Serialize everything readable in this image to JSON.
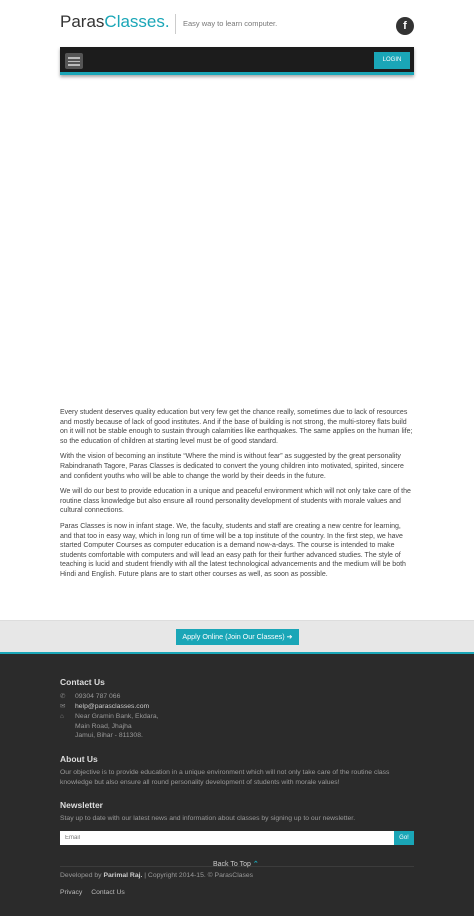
{
  "header": {
    "logo_part1": "Paras",
    "logo_part2": "Classes.",
    "tagline": "Easy way to learn computer.",
    "facebook_glyph": "f"
  },
  "navbar": {
    "login_label": "LOGIN"
  },
  "content": {
    "paragraphs": [
      "Every student deserves quality education but very few get the chance really, sometimes due to lack of resources and mostly because of lack of good institutes. And if the base of building is not strong, the multi-storey flats build on it will not be stable enough to sustain through calamities like earthquakes. The same applies on the human life; so the education of children at starting level must be of good standard.",
      "With the vision of becoming an institute “Where the mind is without fear” as suggested by the great personality Rabindranath Tagore, Paras Classes is dedicated to convert the young children into motivated, spirited, sincere and confident youths who will be able to change the world by their deeds in the future.",
      "We will do our best to provide education in a unique and peaceful environment which will not only take care of the routine class knowledge but also ensure all round personality development of students with morale values and cultural connections.",
      "Paras Classes is now in infant stage. We, the faculty, students and staff are creating a new centre for learning, and that too in easy way, which in long run of time will be a top institute of the country. In the first step, we have started Computer Courses as computer education is a demand now-a-days. The course is intended to make students comfortable with computers and will lead an easy path for their further advanced studies. The style of teaching is lucid and student friendly with all the latest technological advancements and the medium will be both Hindi and English. Future plans are to start other courses as well, as soon as possible."
    ]
  },
  "cta": {
    "label": "Apply Online (Join Our Classes) ➔"
  },
  "footer": {
    "contact_heading": "Contact Us",
    "phone": "09304 787 066",
    "email": "help@parasclasses.com",
    "address_line1": "Near Gramin Bank, Ekdara,",
    "address_line2": "Main Road, Jhajha",
    "address_line3": "Jamui, Bihar - 811308.",
    "about_heading": "About Us",
    "about_text": "Our objective is to provide education in a unique environment which will not only take care of the routine class knowledge but also ensure all round personality development of students with morale values!",
    "newsletter_heading": "Newsletter",
    "newsletter_text": "Stay up to date with our latest news and information about classes by signing up to our newsletter.",
    "email_placeholder": "Email",
    "go_label": "Go!",
    "back_to_top": "Back To Top",
    "developed_prefix": "Developed by",
    "developer": "Parimal Raj.",
    "copyright": "| Copyright 2014-15. © ParasClases",
    "links": [
      "Privacy",
      "Contact Us"
    ]
  },
  "colors": {
    "accent": "#1aa6b7",
    "navbar_bg": "#1c1c1c",
    "footer_bg": "#2b2b2b",
    "cta_band_bg": "#e7e7e7"
  },
  "icons": {
    "facebook": "facebook-icon",
    "menu": "hamburger-menu-icon",
    "phone": "phone-icon",
    "email": "envelope-icon",
    "address": "home-icon",
    "back_to_top": "chevron-up-icon"
  }
}
